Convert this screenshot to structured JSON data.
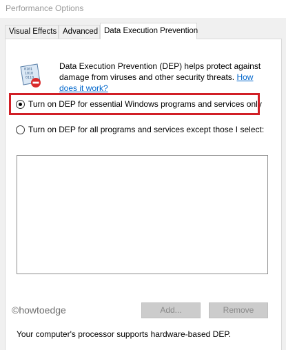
{
  "window": {
    "title": "Performance Options"
  },
  "tabs": [
    {
      "label": "Visual Effects"
    },
    {
      "label": "Advanced"
    },
    {
      "label": "Data Execution Prevention"
    }
  ],
  "active_tab": "Data Execution Prevention",
  "dep": {
    "icon": "dep-shield-icon",
    "description": "Data Execution Prevention (DEP) helps protect against damage from viruses and other security threats.",
    "link_text": "How does it work?",
    "options": [
      {
        "label": "Turn on DEP for essential Windows programs and services only",
        "checked": true
      },
      {
        "label": "Turn on DEP for all programs and services except those I select:",
        "checked": false
      }
    ],
    "buttons": {
      "add": "Add...",
      "remove": "Remove"
    },
    "status": "Your computer's processor supports hardware-based DEP.",
    "watermark": "©howtoedge"
  },
  "colors": {
    "highlight": "#d11f26",
    "link": "#0066cc"
  }
}
